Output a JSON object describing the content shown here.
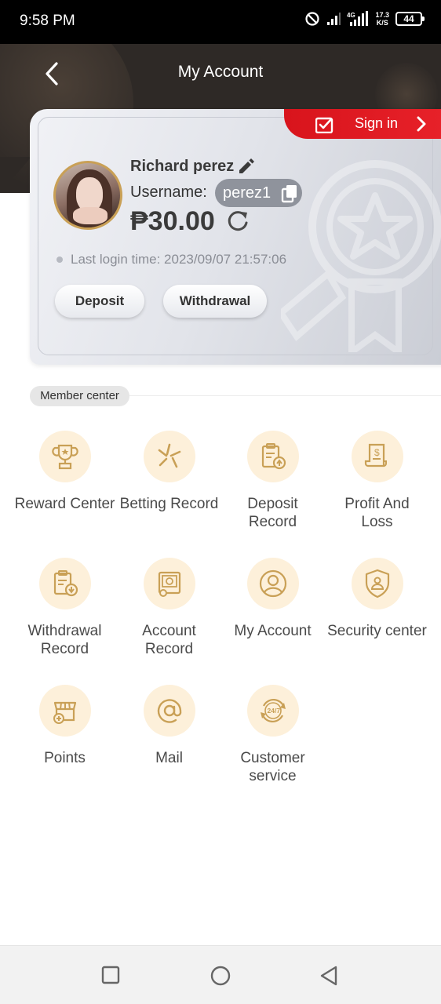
{
  "status_bar": {
    "time": "9:58 PM",
    "net_speed_value": "17.3",
    "net_speed_unit": "K/S",
    "battery": "44",
    "icons": [
      "dnd-icon",
      "signal-icon",
      "4g-signal-icon",
      "battery-icon"
    ]
  },
  "header": {
    "title": "My Account",
    "back_icon": "chevron-left-icon"
  },
  "card": {
    "signin_label": "Sign in",
    "name": "Richard perez",
    "username_label": "Username:",
    "username": "perez1",
    "balance": "₱30.00",
    "last_login": "Last login time: 2023/09/07 21:57:06",
    "deposit_label": "Deposit",
    "withdraw_label": "Withdrawal"
  },
  "member_center": {
    "tag": "Member center",
    "items": [
      {
        "line1": "Reward Center",
        "line2": "",
        "icon": "trophy-icon"
      },
      {
        "line1": "Betting Record",
        "line2": "",
        "icon": "betting-icon"
      },
      {
        "line1": "Deposit",
        "line2": "Record",
        "icon": "deposit-record-icon"
      },
      {
        "line1": "Profit And",
        "line2": "Loss",
        "icon": "receipt-icon"
      },
      {
        "line1": "Withdrawal",
        "line2": "Record",
        "icon": "withdraw-record-icon"
      },
      {
        "line1": "Account",
        "line2": "Record",
        "icon": "account-record-icon"
      },
      {
        "line1": "My Account",
        "line2": "",
        "icon": "user-icon"
      },
      {
        "line1": "Security center",
        "line2": "",
        "icon": "shield-icon"
      },
      {
        "line1": "Points",
        "line2": "",
        "icon": "points-store-icon"
      },
      {
        "line1": "Mail",
        "line2": "",
        "icon": "at-icon"
      },
      {
        "line1": "Customer",
        "line2": "service",
        "icon": "support-24-7-icon"
      }
    ]
  },
  "colors": {
    "header_bg": "#2e2926",
    "signin_red": "#e8222a",
    "icon_circle": "#fdf0da",
    "icon_gold": "#c9a056"
  }
}
